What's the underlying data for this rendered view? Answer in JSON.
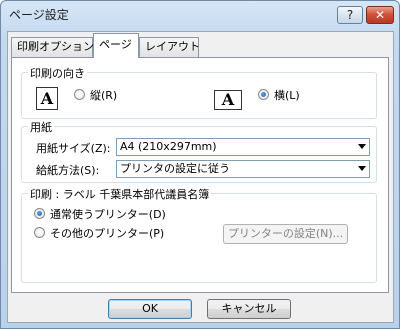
{
  "window": {
    "title": "ページ設定",
    "help_label": "?",
    "close_label": "✕"
  },
  "tabs": [
    {
      "label": "印刷オプション",
      "selected": false
    },
    {
      "label": "ページ",
      "selected": true
    },
    {
      "label": "レイアウト",
      "selected": false
    }
  ],
  "orientation": {
    "title": "印刷の向き",
    "portrait": {
      "icon": "paper-portrait-icon",
      "letter": "A",
      "label": "縦(R)",
      "selected": false
    },
    "landscape": {
      "icon": "paper-landscape-icon",
      "letter": "A",
      "label": "横(L)",
      "selected": true
    }
  },
  "paper": {
    "title": "用紙",
    "size_label": "用紙サイズ(Z):",
    "size_value": "A4 (210x297mm)",
    "source_label": "給紙方法(S):",
    "source_value": "プリンタの設定に従う"
  },
  "printer": {
    "title": "印刷 : ラベル 千葉県本部代議員名簿",
    "default_printer_label": "通常使うプリンター(D)",
    "default_selected": true,
    "other_printer_label": "その他のプリンター(P)",
    "other_selected": false,
    "printer_settings_label": "プリンターの設定(N)..."
  },
  "footer": {
    "ok_label": "OK",
    "cancel_label": "キャンセル"
  }
}
